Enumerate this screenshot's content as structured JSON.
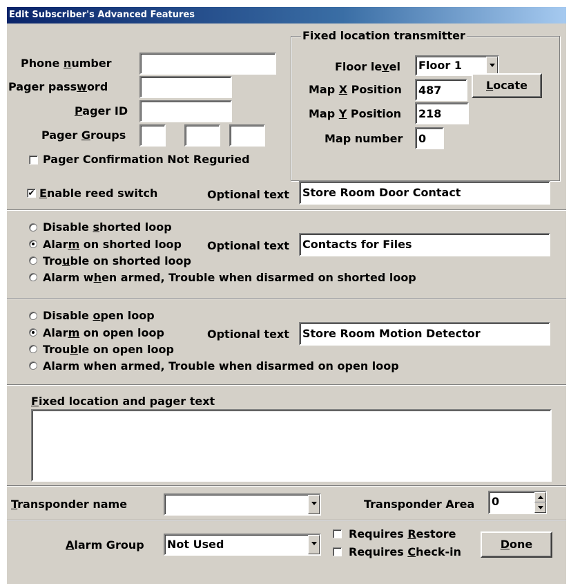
{
  "window": {
    "title": "Edit Subscriber's Advanced Features"
  },
  "pager": {
    "phone_label": "Phone number",
    "phone_value": "",
    "password_label": "Pager password",
    "password_value": "",
    "id_label": "Pager ID",
    "id_value": "",
    "groups_label": "Pager Groups",
    "groups_values": [
      "",
      "",
      ""
    ],
    "confirmation_label": "Pager Confirmation Not Reguried",
    "confirmation_checked": false
  },
  "transmitter": {
    "group_title": "Fixed location transmitter",
    "floor_label": "Floor level",
    "floor_value": "Floor 1",
    "mapx_label": "Map X Position",
    "mapx_value": "487",
    "mapy_label": "Map Y Position",
    "mapy_value": "218",
    "mapnum_label": "Map number",
    "mapnum_value": "0",
    "locate_label": "Locate"
  },
  "reed": {
    "enable_label": "Enable reed switch",
    "enable_checked": true,
    "optional_label": "Optional text",
    "optional_value": "Store Room Door Contact"
  },
  "shorted": {
    "options": [
      "Disable shorted loop",
      "Alarm on shorted loop",
      "Trouble on shorted loop",
      "Alarm when armed, Trouble when disarmed on shorted loop"
    ],
    "selected": 1,
    "optional_label": "Optional text",
    "optional_value": "Contacts for Files"
  },
  "open": {
    "options": [
      "Disable open loop",
      "Alarm on open loop",
      "Trouble on open loop",
      "Alarm when armed, Trouble when disarmed on open loop"
    ],
    "selected": 1,
    "optional_label": "Optional text",
    "optional_value": "Store Room Motion Detector"
  },
  "fixed_text": {
    "label": "Fixed location and pager text",
    "value": ""
  },
  "transponder": {
    "name_label": "Transponder name",
    "name_value": "",
    "area_label": "Transponder Area",
    "area_value": "0"
  },
  "alarm": {
    "group_label": "Alarm Group",
    "group_value": "Not Used",
    "requires_restore_label": "Requires Restore",
    "requires_restore_checked": false,
    "requires_checkin_label": "Requires Check-in",
    "requires_checkin_checked": false,
    "done_label": "Done"
  }
}
